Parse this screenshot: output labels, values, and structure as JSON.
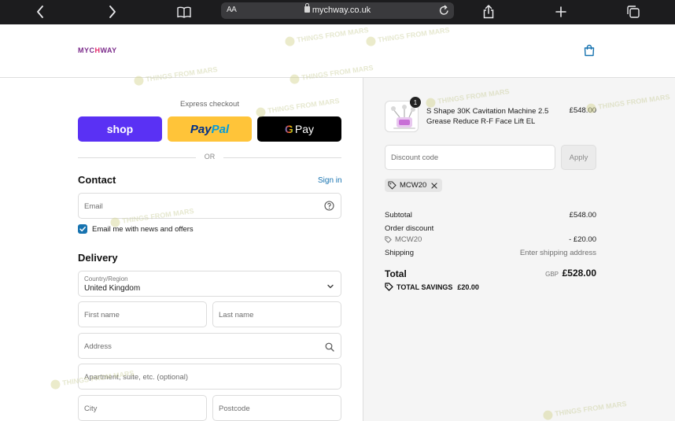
{
  "browser": {
    "aa_label": "AA",
    "url": "mychway.co.uk"
  },
  "store": {
    "logo_before": "MYC",
    "logo_o": "H",
    "logo_after": "WAY"
  },
  "express": {
    "label": "Express checkout",
    "shop_label": "shop",
    "paypal_part1": "Pay",
    "paypal_part2": "Pal",
    "gpay_g": "G",
    "gpay_label": "Pay",
    "or_label": "OR"
  },
  "contact": {
    "title": "Contact",
    "sign_in": "Sign in",
    "email_placeholder": "Email",
    "newsletter_label": "Email me with news and offers"
  },
  "delivery": {
    "title": "Delivery",
    "country_label": "Country/Region",
    "country_value": "United Kingdom",
    "first_name_placeholder": "First name",
    "last_name_placeholder": "Last name",
    "address_placeholder": "Address",
    "apartment_placeholder": "Apartment, suite, etc. (optional)",
    "city_placeholder": "City",
    "postcode_placeholder": "Postcode"
  },
  "summary": {
    "item": {
      "quantity": "1",
      "name": "S Shape 30K Cavitation Machine 2.5 Grease Reduce R-F Face Lift EL",
      "price": "£548.00"
    },
    "discount_placeholder": "Discount code",
    "apply_label": "Apply",
    "applied_code": "MCW20",
    "subtotal_label": "Subtotal",
    "subtotal_value": "£548.00",
    "order_discount_label": "Order discount",
    "discount_code": "MCW20",
    "discount_value": "- £20.00",
    "shipping_label": "Shipping",
    "shipping_value": "Enter shipping address",
    "total_label": "Total",
    "total_currency": "GBP",
    "total_value": "£528.00",
    "savings_label": "TOTAL SAVINGS",
    "savings_value": "£20.00"
  },
  "watermark": "THINGS FROM MARS",
  "colors": {
    "shop": "#5a31f4",
    "paypal": "#ffc439",
    "link": "#1773b0",
    "checkbox": "#1773b0"
  }
}
